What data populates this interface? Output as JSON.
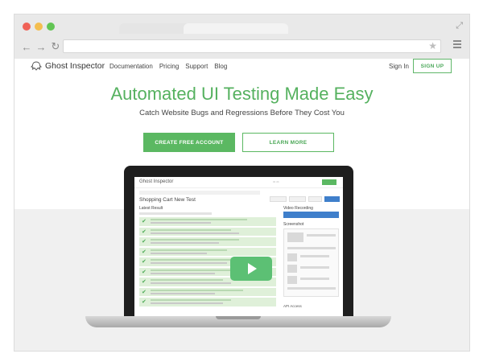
{
  "browser": {
    "nav": {
      "back": "←",
      "forward": "→",
      "reload": "↻"
    },
    "icons": {
      "star": "star-icon",
      "menu": "menu-icon",
      "expand": "expand-icon"
    }
  },
  "header": {
    "logo_text": "Ghost Inspector",
    "nav": [
      "Documentation",
      "Pricing",
      "Support",
      "Blog"
    ],
    "sign_in": "Sign In",
    "sign_up": "SIGN UP"
  },
  "hero": {
    "title": "Automated UI Testing Made Easy",
    "subtitle": "Catch Website Bugs and Regressions Before They Cost You",
    "cta_primary": "CREATE FREE ACCOUNT",
    "cta_secondary": "LEARN MORE"
  },
  "screen": {
    "logo_text": "Ghost Inspector",
    "test_title": "Shopping Cart New Test",
    "latest_result": "Latest Result",
    "video_recording": "Video Recording",
    "screenshot": "Screenshot",
    "api_access": "API Access",
    "step_count": 9
  },
  "colors": {
    "accent_green": "#5bb862",
    "title_green": "#55b15f",
    "video_blue": "#3f7fcb",
    "step_bg": "#dff0d9"
  }
}
